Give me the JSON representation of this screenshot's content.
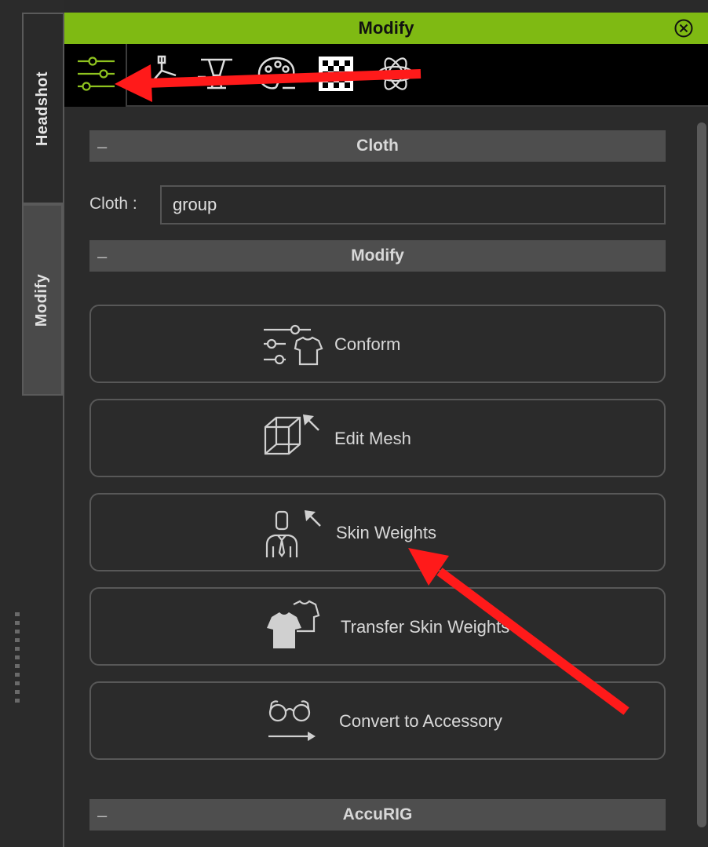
{
  "window": {
    "title": "Modify"
  },
  "side_tabs": [
    "Headshot",
    "Modify"
  ],
  "toolbar": {
    "icons": [
      "modify-sliders-icon",
      "pose-icon",
      "morph-icon",
      "material-icon",
      "texture-checker-icon",
      "physics-atom-icon"
    ]
  },
  "sections": {
    "cloth": {
      "title": "Cloth",
      "collapse": "–"
    },
    "modify": {
      "title": "Modify",
      "collapse": "–"
    },
    "accurig": {
      "title": "AccuRIG",
      "collapse": "–"
    }
  },
  "cloth_field": {
    "label": "Cloth :",
    "value": "group"
  },
  "buttons": [
    {
      "label": "Conform",
      "icon": "conform-icon"
    },
    {
      "label": "Edit Mesh",
      "icon": "edit-mesh-icon"
    },
    {
      "label": "Skin Weights",
      "icon": "skin-weights-icon"
    },
    {
      "label": "Transfer Skin Weights",
      "icon": "transfer-skin-weights-icon"
    },
    {
      "label": "Convert to Accessory",
      "icon": "convert-accessory-icon"
    }
  ],
  "colors": {
    "title_bar": "#7fba13",
    "annotation_arrow": "#ff1a1a"
  }
}
